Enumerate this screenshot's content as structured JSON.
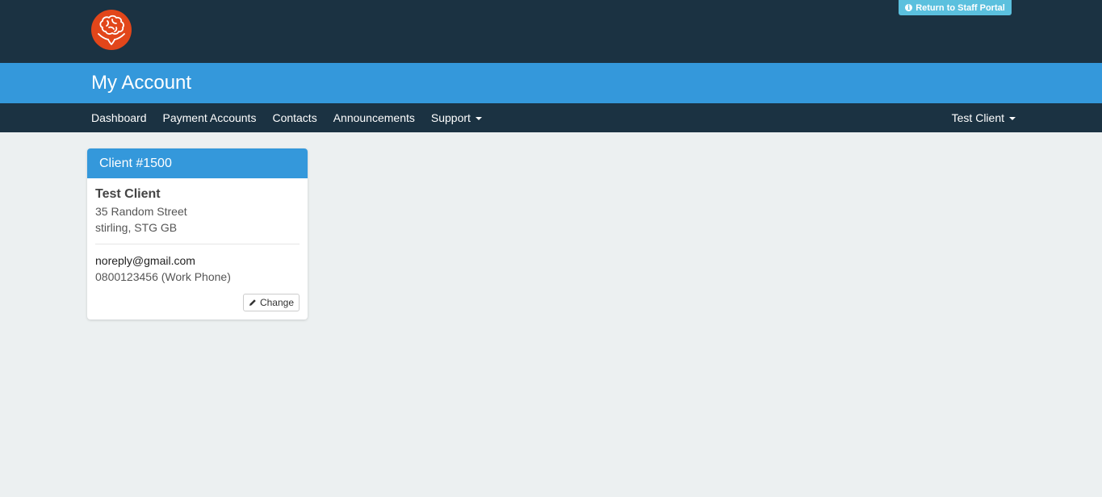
{
  "header": {
    "logo_icon": "brain-hands-logo",
    "staff_portal_label": "Return to Staff Portal",
    "staff_portal_icon": "info-circle-icon",
    "colors": {
      "header_bg": "#1b3242",
      "accent": "#3498db",
      "logo": "#e2461a",
      "staff_btn": "#5bc0de"
    }
  },
  "title_bar": {
    "title": "My Account"
  },
  "nav": {
    "items": [
      {
        "label": "Dashboard"
      },
      {
        "label": "Payment Accounts"
      },
      {
        "label": "Contacts"
      },
      {
        "label": "Announcements"
      },
      {
        "label": "Support",
        "dropdown": true
      }
    ],
    "user_menu_label": "Test Client"
  },
  "client_card": {
    "header": "Client #1500",
    "name": "Test Client",
    "address_line1": "35 Random Street",
    "address_line2": "stirling, STG GB",
    "email": "noreply@gmail.com",
    "phone": "0800123456 (Work Phone)",
    "change_label": "Change",
    "change_icon": "pencil-icon"
  }
}
